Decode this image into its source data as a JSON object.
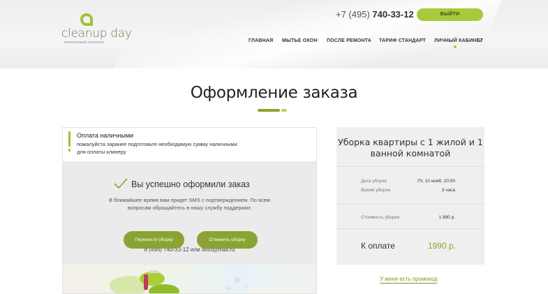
{
  "header": {
    "logo": {
      "text": "cleanup day",
      "subtitle": "клининговый оператор"
    },
    "phone_prefix": "+7 (495)",
    "phone_main": "740-33-12",
    "login_label": "ВЫЙТИ",
    "nav": [
      "ГЛАВНАЯ",
      "МЫТЬЕ ОКОН",
      "ПОСЛЕ РЕМОНТА",
      "ТАРИФ СТАНДАРТ",
      "ЛИЧНЫЙ КАБИНЕТ"
    ],
    "active_nav": "ЛИЧНЫЙ КАБИНЕТ"
  },
  "page": {
    "title": "Оформление заказа"
  },
  "notice": {
    "title": "Оплата наличными",
    "text": "пожалуйста заранее подготовьте необходимую сумму наличными для оплаты клинеру"
  },
  "success": {
    "title": "Вы успешно оформили заказ",
    "text": "В ближайшее время вам придет SMS с подтверждением. По всем вопросам обращайтесь в нашу службу поддержки:",
    "contact": "8 (495) 740-33-12 или onfo@mail.ru",
    "reschedule_label": "Перенести уборку",
    "cancel_label": "Отменить уборку"
  },
  "order": {
    "title": "Уборка квартиры с 1 жилой и 1 ванной комнатой",
    "date_label": "Дата уборки",
    "date_value": "Пт, 10 нояб. 20:00",
    "duration_label": "Время уборки",
    "duration_value": "3 часа",
    "cost_label": "Стоимость уборки",
    "cost_value": "1 990 р.",
    "pay_label": "К оплате",
    "pay_value": "1990 р."
  },
  "promo_label": "У меня есть промокод",
  "colors": {
    "accent": "#a9c93a",
    "accent_dark": "#8aa332",
    "card_bg": "#efefef",
    "success_bg": "#ebebeb"
  },
  "icons": [
    "leaf-logo-icon",
    "chevron-down-icon",
    "checkmark-icon"
  ]
}
